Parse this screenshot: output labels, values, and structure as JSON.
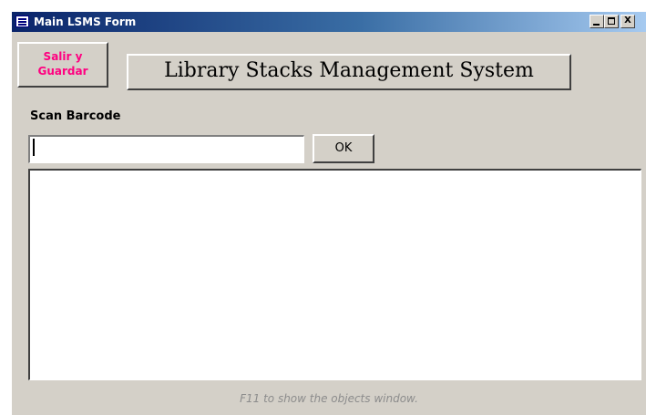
{
  "window": {
    "title": "Main LSMS Form",
    "icon": "form-icon",
    "controls": {
      "minimize_icon": "minimize-icon",
      "maximize_icon": "maximize-icon",
      "close_label": "X"
    }
  },
  "header": {
    "exit_button": {
      "line1": "Salir y",
      "line2": "Guardar",
      "color": "#ff0080"
    },
    "system_title": "Library Stacks Management System"
  },
  "scan": {
    "label": "Scan Barcode",
    "input_value": "",
    "ok_label": "OK"
  },
  "results": {
    "items": []
  },
  "footer": {
    "hint": "F11 to show the objects window."
  },
  "colors": {
    "window_background": "#d4d0c8",
    "titlebar_start": "#0a246a",
    "titlebar_end": "#a6caf0",
    "hint_text": "#8c8c8c"
  }
}
